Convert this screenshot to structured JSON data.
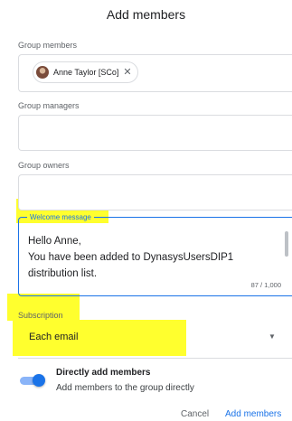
{
  "dialog": {
    "title": "Add members"
  },
  "group_members": {
    "label": "Group members",
    "chips": [
      {
        "name": "Anne Taylor [SCo]"
      }
    ]
  },
  "group_managers": {
    "label": "Group managers"
  },
  "group_owners": {
    "label": "Group owners"
  },
  "welcome_message": {
    "label": "Welcome message",
    "lines": [
      "Hello Anne,",
      "You have been added to DynasysUsersDIP1",
      "distribution list."
    ],
    "counter": "87 / 1,000"
  },
  "subscription": {
    "label": "Subscription",
    "selected": "Each email"
  },
  "direct_add": {
    "title": "Directly add members",
    "description": "Add members to the group directly",
    "enabled": true
  },
  "actions": {
    "cancel": "Cancel",
    "add": "Add members"
  },
  "colors": {
    "accent": "#1a73e8",
    "highlight": "#ffff2e"
  }
}
